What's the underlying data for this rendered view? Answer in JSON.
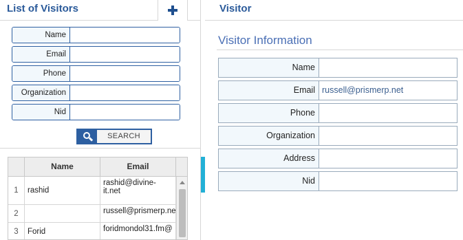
{
  "left": {
    "title": "List of Visitors",
    "add_icon": "plus-icon",
    "search_fields": [
      {
        "label": "Name",
        "value": ""
      },
      {
        "label": "Email",
        "value": ""
      },
      {
        "label": "Phone",
        "value": ""
      },
      {
        "label": "Organization",
        "value": ""
      },
      {
        "label": "Nid",
        "value": ""
      }
    ],
    "search_button": {
      "label": "SEARCH",
      "icon": "search-icon"
    },
    "grid": {
      "columns": [
        "",
        "Name",
        "Email"
      ],
      "rows": [
        {
          "index": "1",
          "name": "rashid",
          "email": "rashid@divine-it.net"
        },
        {
          "index": "2",
          "name": "",
          "email": "russell@prismerp.ne"
        },
        {
          "index": "3",
          "name": "Forid",
          "email": "foridmondol31.fm@"
        }
      ]
    }
  },
  "right": {
    "title": "Visitor",
    "section_title": "Visitor Information",
    "fields": [
      {
        "label": "Name",
        "value": ""
      },
      {
        "label": "Email",
        "value": "russell@prismerp.net"
      },
      {
        "label": "Phone",
        "value": ""
      },
      {
        "label": "Organization",
        "value": ""
      },
      {
        "label": "Address",
        "value": ""
      },
      {
        "label": "Nid",
        "value": ""
      }
    ]
  },
  "colors": {
    "accent": "#2d5fa1",
    "title": "#2a5a9a",
    "splitter": "#22b0d6"
  }
}
